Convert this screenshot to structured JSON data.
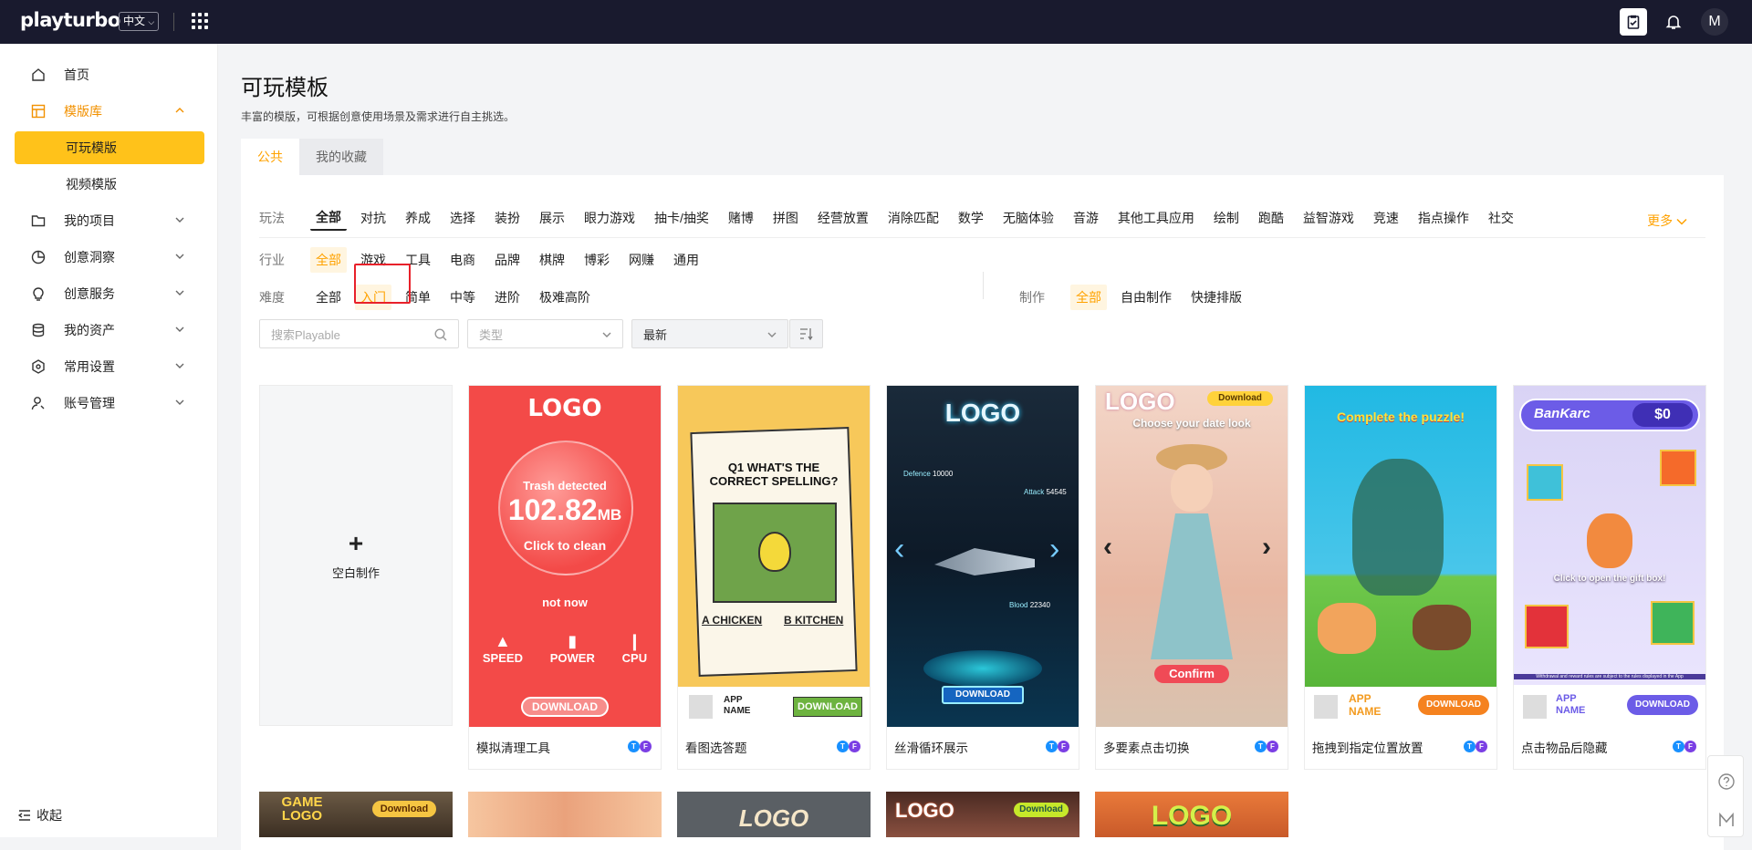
{
  "topbar": {
    "logo_main": "playturbo",
    "lang": "中文",
    "avatar": "M"
  },
  "sidebar": {
    "items": [
      {
        "label": "首页"
      },
      {
        "label": "模版库"
      },
      {
        "label": "可玩模版"
      },
      {
        "label": "视频模版"
      },
      {
        "label": "我的项目"
      },
      {
        "label": "创意洞察"
      },
      {
        "label": "创意服务"
      },
      {
        "label": "我的资产"
      },
      {
        "label": "常用设置"
      },
      {
        "label": "账号管理"
      }
    ],
    "collapse_label": "收起"
  },
  "page": {
    "title": "可玩模板",
    "subtitle": "丰富的模版，可根据创意使用场景及需求进行自主挑选。"
  },
  "tabs": [
    "公共",
    "我的收藏"
  ],
  "filters": {
    "gameplay_label": "玩法",
    "gameplay": [
      "全部",
      "对抗",
      "养成",
      "选择",
      "装扮",
      "展示",
      "眼力游戏",
      "抽卡/抽奖",
      "赌博",
      "拼图",
      "经营放置",
      "消除匹配",
      "数学",
      "无脑体验",
      "音游",
      "其他工具应用",
      "绘制",
      "跑酷",
      "益智游戏",
      "竞速",
      "指点操作",
      "社交"
    ],
    "more": "更多",
    "industry_label": "行业",
    "industry": [
      "全部",
      "游戏",
      "工具",
      "电商",
      "品牌",
      "棋牌",
      "博彩",
      "网赚",
      "通用"
    ],
    "difficulty_label": "难度",
    "difficulty": [
      "全部",
      "入门",
      "简单",
      "中等",
      "进阶",
      "极难高阶"
    ],
    "make_label": "制作",
    "make": [
      "全部",
      "自由制作",
      "快捷排版"
    ]
  },
  "search": {
    "placeholder": "搜索Playable",
    "type_placeholder": "类型",
    "sort_value": "最新"
  },
  "blank_card": {
    "plus": "+",
    "label": "空白制作"
  },
  "cards": [
    {
      "name": "模拟清理工具",
      "logo": "LOGO",
      "line1": "Trash detected",
      "value": "102.82",
      "unit": "MB",
      "cta": "Click to clean",
      "not_now": "not now",
      "icons": [
        "SPEED",
        "POWER",
        "CPU"
      ],
      "download": "DOWNLOAD"
    },
    {
      "name": "看图选答题",
      "question": "Q1 WHAT'S THE CORRECT SPELLING?",
      "opt_a": "A CHICKEN",
      "opt_b": "B KITCHEN",
      "app": "APP NAME",
      "download": "DOWNLOAD"
    },
    {
      "name": "丝滑循环展示",
      "logo": "LOGO",
      "defence": "Defence",
      "defence_v": "10000",
      "attack": "Attack",
      "attack_v": "54545",
      "blood": "Blood",
      "blood_v": "22340",
      "download": "DOWNLOAD"
    },
    {
      "name": "多要素点击切换",
      "logo": "LOGO",
      "download": "Download",
      "caption": "Choose your date look",
      "confirm": "Confirm"
    },
    {
      "name": "拖拽到指定位置放置",
      "caption": "Complete the puzzle!",
      "app": "APP NAME",
      "download": "DOWNLOAD"
    },
    {
      "name": "点击物品后隐藏",
      "brand": "BanKarc",
      "amount": "$0",
      "caption": "Click to open the gift box!",
      "app": "APP NAME",
      "download": "DOWNLOAD",
      "fine": "Withdrawal and reward rules are subject to the rules displayed in the App"
    }
  ],
  "row2": [
    {
      "logo": "GAME LOGO",
      "download": "Download"
    },
    {
      "logo": ""
    },
    {
      "logo": "LOGO"
    },
    {
      "logo": "LOGO",
      "download": "Download"
    },
    {
      "logo": "LOGO"
    }
  ],
  "colors": {
    "accent": "#ffc21a",
    "accent_text": "#ffa200",
    "topbar": "#191a2e",
    "highlight": "#e8212a"
  }
}
